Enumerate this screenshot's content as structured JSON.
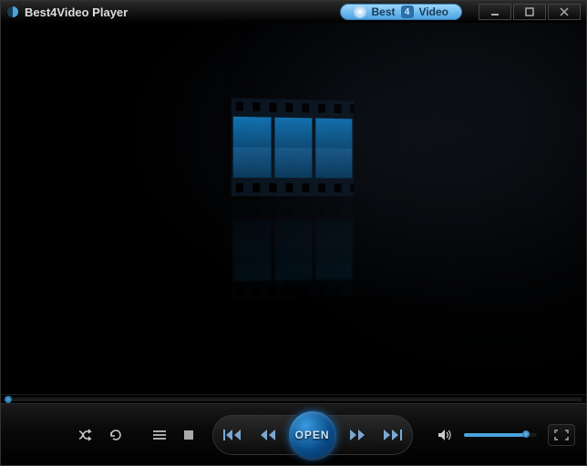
{
  "window": {
    "title": "Best4Video Player",
    "brand": {
      "pre": "Best",
      "num": "4",
      "post": "Video"
    }
  },
  "controls": {
    "open_label": "OPEN"
  },
  "seek": {
    "position_pct": 0
  },
  "volume": {
    "level_pct": 85
  }
}
